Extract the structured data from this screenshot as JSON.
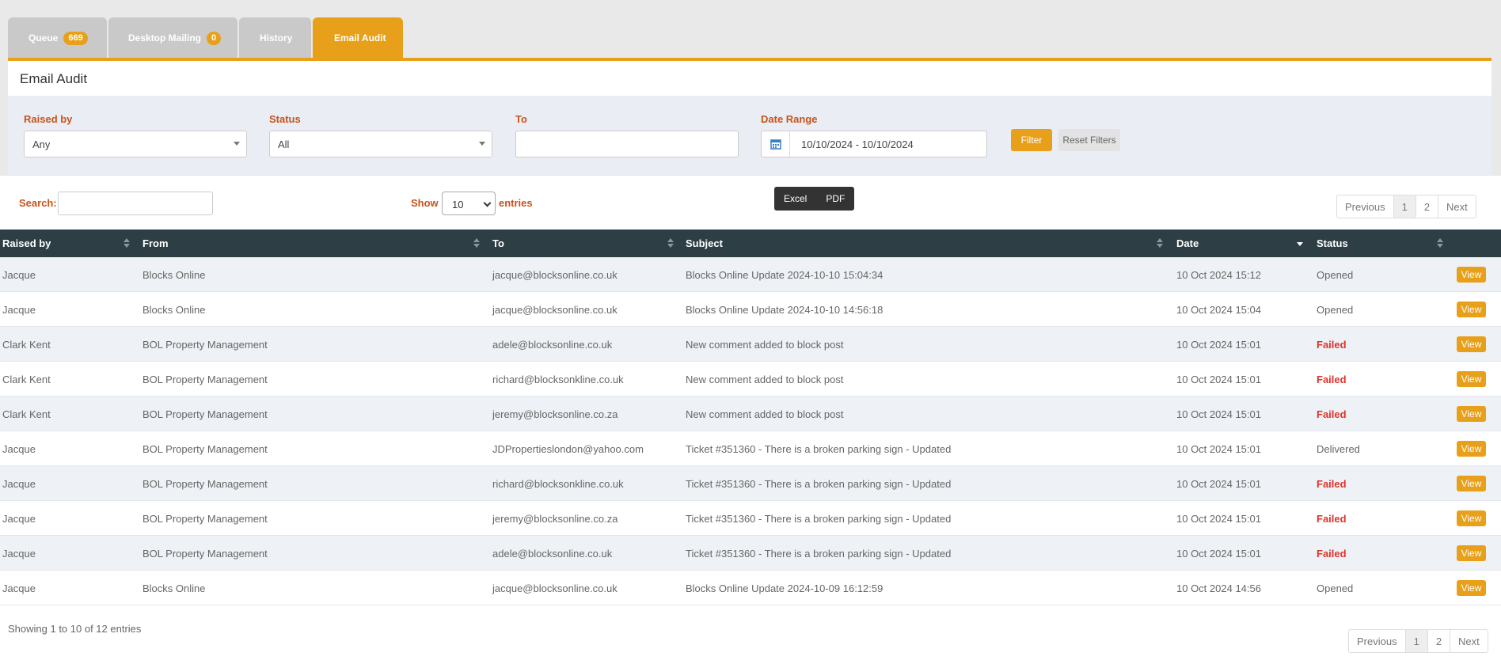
{
  "tabs": [
    {
      "label": "Queue",
      "count": "669"
    },
    {
      "label": "Desktop Mailing",
      "count": "0"
    },
    {
      "label": "History"
    },
    {
      "label": "Email Audit"
    }
  ],
  "panel": {
    "title": "Email Audit"
  },
  "filters": {
    "raised_by": {
      "label": "Raised by",
      "value": "Any"
    },
    "status": {
      "label": "Status",
      "value": "All"
    },
    "to": {
      "label": "To",
      "value": ""
    },
    "date_range": {
      "label": "Date Range",
      "value": "10/10/2024 - 10/10/2024"
    },
    "filter_button": "Filter",
    "reset_button": "Reset Filters"
  },
  "toolbar": {
    "search_label": "Search:",
    "show_label": "Show",
    "show_value": "10",
    "entries_label": "entries",
    "export": [
      "Excel",
      "PDF"
    ]
  },
  "pagination": {
    "previous": "Previous",
    "pages": [
      "1",
      "2"
    ],
    "next": "Next",
    "current": "1"
  },
  "table": {
    "columns": [
      "Raised by",
      "From",
      "To",
      "Subject",
      "Date",
      "Status"
    ],
    "rows": [
      {
        "raised_by": "Jacque",
        "from": "Blocks Online",
        "to": "jacque@blocksonline.co.uk",
        "subject": "Blocks Online Update 2024-10-10 15:04:34",
        "date": "10 Oct 2024 15:12",
        "status": "Opened",
        "action": "View"
      },
      {
        "raised_by": "Jacque",
        "from": "Blocks Online",
        "to": "jacque@blocksonline.co.uk",
        "subject": "Blocks Online Update 2024-10-10 14:56:18",
        "date": "10 Oct 2024 15:04",
        "status": "Opened",
        "action": "View"
      },
      {
        "raised_by": "Clark Kent",
        "from": "BOL Property Management",
        "to": "adele@blocksonline.co.uk",
        "subject": "New comment added to block post",
        "date": "10 Oct 2024 15:01",
        "status": "Failed",
        "action": "View"
      },
      {
        "raised_by": "Clark Kent",
        "from": "BOL Property Management",
        "to": "richard@blocksonkline.co.uk",
        "subject": "New comment added to block post",
        "date": "10 Oct 2024 15:01",
        "status": "Failed",
        "action": "View"
      },
      {
        "raised_by": "Clark Kent",
        "from": "BOL Property Management",
        "to": "jeremy@blocksonline.co.za",
        "subject": "New comment added to block post",
        "date": "10 Oct 2024 15:01",
        "status": "Failed",
        "action": "View"
      },
      {
        "raised_by": "Jacque",
        "from": "BOL Property Management",
        "to": "JDPropertieslondon@yahoo.com",
        "subject": "Ticket #351360 - There is a broken parking sign - Updated",
        "date": "10 Oct 2024 15:01",
        "status": "Delivered",
        "action": "View"
      },
      {
        "raised_by": "Jacque",
        "from": "BOL Property Management",
        "to": "richard@blocksonkline.co.uk",
        "subject": "Ticket #351360 - There is a broken parking sign - Updated",
        "date": "10 Oct 2024 15:01",
        "status": "Failed",
        "action": "View"
      },
      {
        "raised_by": "Jacque",
        "from": "BOL Property Management",
        "to": "jeremy@blocksonline.co.za",
        "subject": "Ticket #351360 - There is a broken parking sign - Updated",
        "date": "10 Oct 2024 15:01",
        "status": "Failed",
        "action": "View"
      },
      {
        "raised_by": "Jacque",
        "from": "BOL Property Management",
        "to": "adele@blocksonline.co.uk",
        "subject": "Ticket #351360 - There is a broken parking sign - Updated",
        "date": "10 Oct 2024 15:01",
        "status": "Failed",
        "action": "View"
      },
      {
        "raised_by": "Jacque",
        "from": "Blocks Online",
        "to": "jacque@blocksonline.co.uk",
        "subject": "Blocks Online Update 2024-10-09 16:12:59",
        "date": "10 Oct 2024 14:56",
        "status": "Opened",
        "action": "View"
      }
    ]
  },
  "footer": {
    "showing": "Showing 1 to 10 of 12 entries"
  },
  "colors": {
    "accent": "#e8a01a",
    "header_bg": "#2d3e45",
    "label": "#c8531a",
    "failed": "#e0332b"
  }
}
